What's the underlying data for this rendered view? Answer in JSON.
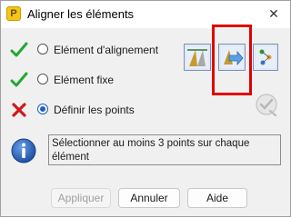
{
  "window": {
    "title": "Aligner les éléments",
    "app_icon_letter": "P",
    "close_glyph": "✕"
  },
  "options": [
    {
      "label": "Elément d'alignement",
      "status": "check",
      "selected": false
    },
    {
      "label": "Elément fixe",
      "status": "check",
      "selected": false
    },
    {
      "label": "Définir les points",
      "status": "cross",
      "selected": true
    }
  ],
  "tool_icons": [
    "align-method-1-icon",
    "align-method-2-icon",
    "align-method-3-icon"
  ],
  "message": "Sélectionner au moins 3 points sur chaque élément",
  "buttons": {
    "apply": "Appliquer",
    "cancel": "Annuler",
    "help": "Aide"
  },
  "colors": {
    "check": "#22a832",
    "cross": "#d01818",
    "radio": "#1e5fbf",
    "highlight": "#e00000",
    "info": "#1f4fa3"
  }
}
